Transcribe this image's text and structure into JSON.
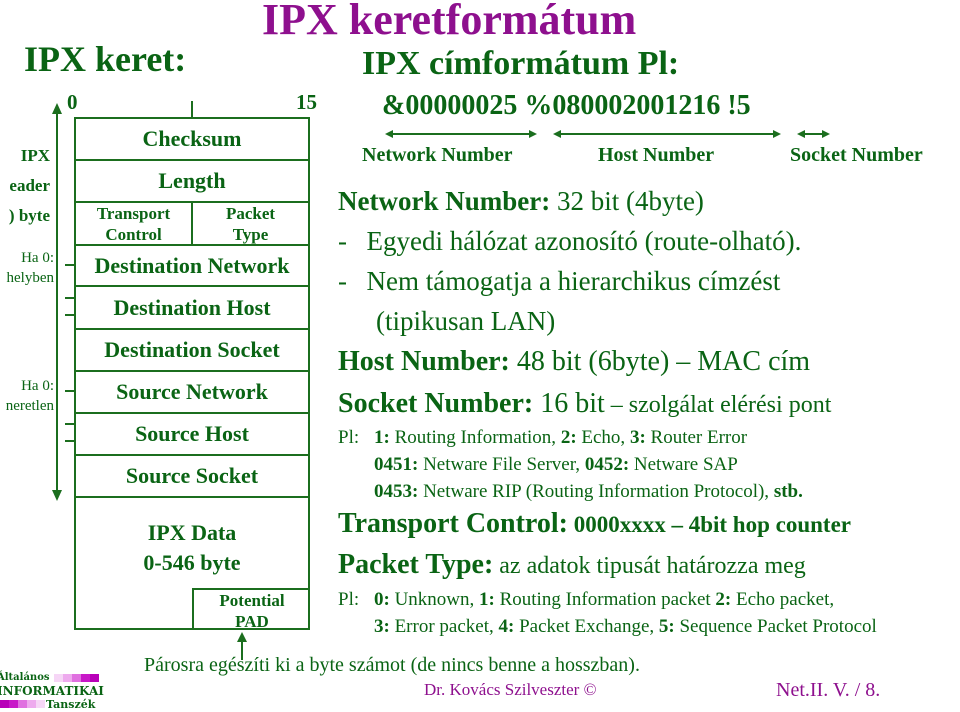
{
  "title": "IPX keretformátum",
  "left_heading": "IPX keret:",
  "bit_ruler": {
    "start": "0",
    "end": "15"
  },
  "frame_fields": {
    "checksum": "Checksum",
    "length": "Length",
    "transport_control": [
      "Transport",
      "Control"
    ],
    "packet_type": [
      "Packet",
      "Type"
    ],
    "destination_network": "Destination Network",
    "destination_host": "Destination Host",
    "destination_socket": "Destination Socket",
    "source_network": "Source Network",
    "source_host": "Source Host",
    "source_socket": "Source Socket",
    "data": [
      "IPX Data",
      "0-546 byte"
    ],
    "pad": [
      "Potential",
      "PAD"
    ]
  },
  "side_labels": {
    "header": [
      "IPX",
      "eader",
      ") byte"
    ],
    "dest_note": [
      "Ha 0:",
      "helyben"
    ],
    "src_note": [
      "Ha 0:",
      "neretlen"
    ]
  },
  "address_format": {
    "heading": "IPX címformátum Pl:",
    "example": "&00000025 %080002001216 !5",
    "labels": [
      "Network Number",
      "Host Number",
      "Socket Number"
    ]
  },
  "network_number": {
    "label": "Network Number:",
    "value": " 32 bit (4byte)",
    "bullets": [
      "Egyedi hálózat azonosító (route-olható).",
      "Nem támogatja a hierarchikus címzést",
      "(tipikusan LAN)"
    ]
  },
  "host_number": {
    "label": "Host Number:",
    "value": " 48 bit (6byte) – MAC cím"
  },
  "socket_number": {
    "label": "Socket Number:",
    "value": " 16 bit",
    "desc": " – szolgálat elérési pont",
    "examples_prefix": "Pl:",
    "examples": [
      [
        [
          "1:",
          " Routing Information, "
        ],
        [
          "2:",
          " Echo, "
        ],
        [
          "3:",
          " Router Error"
        ]
      ],
      [
        [
          "0451:",
          " Netware File Server, "
        ],
        [
          "0452:",
          " Netware SAP"
        ]
      ],
      [
        [
          "0453:",
          " Netware RIP (Routing Information Protocol), "
        ],
        [
          "stb.",
          ""
        ]
      ]
    ]
  },
  "transport_control": {
    "label": "Transport Control:",
    "value": " 0000xxxx – 4bit hop counter"
  },
  "packet_type": {
    "label": "Packet Type:",
    "value": " az adatok tipusát határozza meg",
    "examples_prefix": "Pl:",
    "examples": [
      [
        [
          "0:",
          " Unknown, "
        ],
        [
          "1:",
          " Routing Information packet "
        ],
        [
          "2:",
          " Echo packet,"
        ]
      ],
      [
        [
          "3:",
          " Error packet, "
        ],
        [
          "4:",
          " Packet Exchange, "
        ],
        [
          "5:",
          " Sequence Packet Protocol"
        ]
      ]
    ]
  },
  "footer_note": "Párosra egészíti ki a byte számot (de nincs benne a hosszban).",
  "author": "Dr. Kovács Szilveszter ©",
  "page": "Net.II. V. / 8.",
  "logo": {
    "line1": "Általános",
    "line2": "INFORMATIKAI",
    "line3": "Tanszék"
  },
  "colors": {
    "green": "#0a6414",
    "purple": "#8e108e",
    "magenta": "#c010c0"
  }
}
